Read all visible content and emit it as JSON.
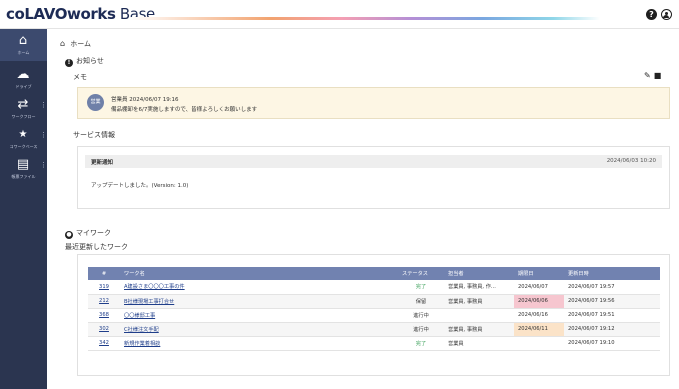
{
  "header": {
    "logo_main": "coLAVOworks",
    "logo_sub": " Base",
    "help_icon": "help-circle-icon",
    "user_icon": "user-circle-icon"
  },
  "sidebar": {
    "items": [
      {
        "label": "ホーム",
        "icon": "home-icon"
      },
      {
        "label": "ドライブ",
        "icon": "cloud-icon"
      },
      {
        "label": "ワークフロー",
        "icon": "workflow-icon"
      },
      {
        "label": "コワークベース",
        "icon": "cowork-icon"
      },
      {
        "label": "帳票ファイル",
        "icon": "documents-icon"
      }
    ]
  },
  "breadcrumb": "ホーム",
  "notice": {
    "title": "お知らせ",
    "memo_label": "メモ",
    "avatar_text": "営業",
    "author_date": "営業員  2024/06/07 19:16",
    "message": "備品棚卸を6/7実施しますので、皆様よろしくお願いします"
  },
  "service": {
    "title": "サービス情報",
    "head": "更新通知",
    "date": "2024/06/03 10:20",
    "message": "アップデートしました。(Version: 1.0)"
  },
  "mywork": {
    "title": "マイワーク",
    "subtitle": "最近更新したワーク",
    "columns": [
      "#",
      "ワーク名",
      "ステータス",
      "担当者",
      "期限日",
      "更新日時"
    ],
    "rows": [
      {
        "id": "319",
        "name": "A建設さま〇〇〇工事の件",
        "status": "完了",
        "assignee": "営業員, 事務員, 作...",
        "deadline": "2024/06/07",
        "updated": "2024/06/07 19:57"
      },
      {
        "id": "212",
        "name": "B社様現場工事打合せ",
        "status": "保留",
        "assignee": "営業員, 事務員",
        "deadline": "2024/06/06",
        "updated": "2024/06/07 19:56"
      },
      {
        "id": "368",
        "name": "〇〇様邸工事",
        "status": "進行中",
        "assignee": "",
        "deadline": "2024/06/16",
        "updated": "2024/06/07 19:51"
      },
      {
        "id": "302",
        "name": "C社様注文手配",
        "status": "進行中",
        "assignee": "営業員, 事務員",
        "deadline": "2024/06/11",
        "updated": "2024/06/07 19:12"
      },
      {
        "id": "342",
        "name": "新規作業着相談",
        "status": "完了",
        "assignee": "営業員",
        "deadline": "",
        "updated": "2024/06/07 19:10"
      }
    ]
  },
  "colors": {
    "sidebar": "#2b3550",
    "table_header": "#7182b0",
    "done_status": "#3ba05a",
    "overdue": "#f6c6cf",
    "due_soon": "#fbe3c8"
  }
}
